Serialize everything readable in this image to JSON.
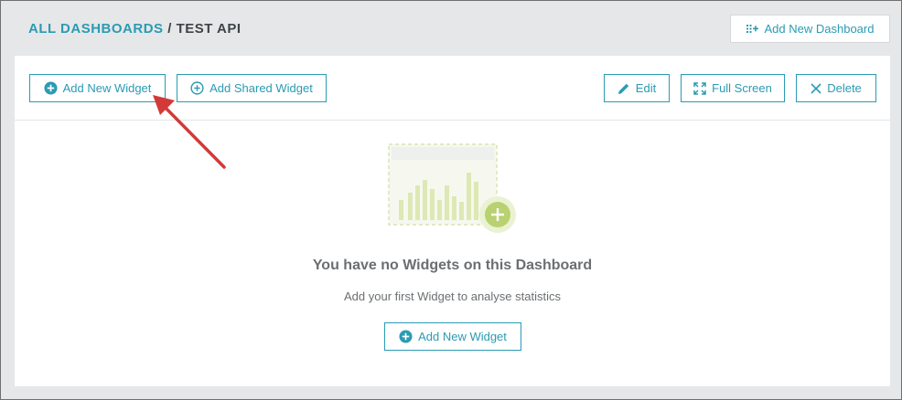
{
  "breadcrumb": {
    "root": "ALL DASHBOARDS",
    "separator": "/",
    "current": "TEST API"
  },
  "header": {
    "add_dashboard_label": "Add New Dashboard"
  },
  "toolbar": {
    "add_widget_label": "Add New Widget",
    "add_shared_label": "Add Shared Widget",
    "edit_label": "Edit",
    "fullscreen_label": "Full Screen",
    "delete_label": "Delete"
  },
  "empty_state": {
    "title": "You have no Widgets on this Dashboard",
    "subtitle": "Add your first Widget to analyse statistics",
    "button_label": "Add New Widget"
  },
  "colors": {
    "accent": "#2a9bb3",
    "annotation_arrow": "#d23a3a",
    "illustration_green": "#a9c95a"
  },
  "icons": [
    "grid-plus-icon",
    "plus-circle-icon",
    "pencil-icon",
    "expand-icon",
    "close-icon",
    "widget-chart-icon"
  ]
}
